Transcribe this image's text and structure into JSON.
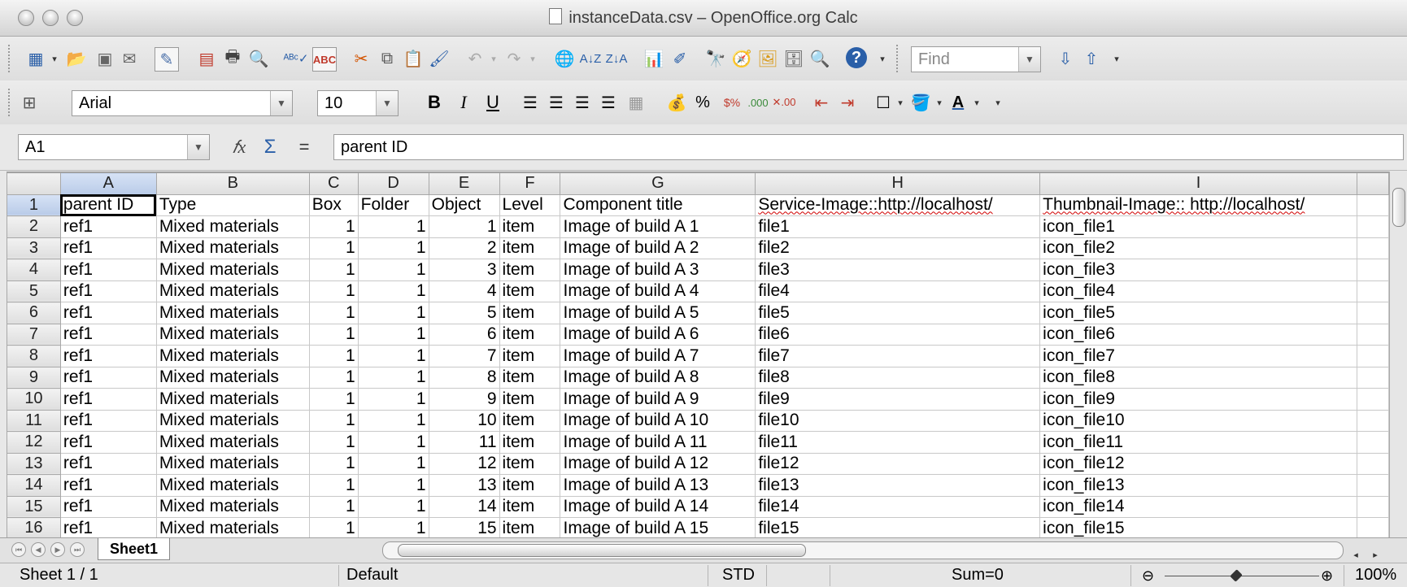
{
  "window": {
    "title": "instanceData.csv – OpenOffice.org Calc"
  },
  "toolbar": {
    "find_placeholder": "Find",
    "font_name": "Arial",
    "font_size": "10"
  },
  "formula_bar": {
    "name_box": "A1",
    "content": "parent ID"
  },
  "columns": [
    "A",
    "B",
    "C",
    "D",
    "E",
    "F",
    "G",
    "H",
    "I"
  ],
  "header_row": [
    "parent ID",
    "Type",
    "Box",
    "Folder",
    "Object",
    "Level",
    "Component title",
    "Service-Image::http://localhost/",
    "Thumbnail-Image:: http://localhost/"
  ],
  "rows": [
    [
      "2",
      "ref1",
      "Mixed materials",
      "1",
      "1",
      "1",
      "item",
      "Image of build A 1",
      "file1",
      "icon_file1"
    ],
    [
      "3",
      "ref1",
      "Mixed materials",
      "1",
      "1",
      "2",
      "item",
      "Image of build A 2",
      "file2",
      "icon_file2"
    ],
    [
      "4",
      "ref1",
      "Mixed materials",
      "1",
      "1",
      "3",
      "item",
      "Image of build A 3",
      "file3",
      "icon_file3"
    ],
    [
      "5",
      "ref1",
      "Mixed materials",
      "1",
      "1",
      "4",
      "item",
      "Image of build A 4",
      "file4",
      "icon_file4"
    ],
    [
      "6",
      "ref1",
      "Mixed materials",
      "1",
      "1",
      "5",
      "item",
      "Image of build A 5",
      "file5",
      "icon_file5"
    ],
    [
      "7",
      "ref1",
      "Mixed materials",
      "1",
      "1",
      "6",
      "item",
      "Image of build A 6",
      "file6",
      "icon_file6"
    ],
    [
      "8",
      "ref1",
      "Mixed materials",
      "1",
      "1",
      "7",
      "item",
      "Image of build A 7",
      "file7",
      "icon_file7"
    ],
    [
      "9",
      "ref1",
      "Mixed materials",
      "1",
      "1",
      "8",
      "item",
      "Image of build A 8",
      "file8",
      "icon_file8"
    ],
    [
      "10",
      "ref1",
      "Mixed materials",
      "1",
      "1",
      "9",
      "item",
      "Image of build A 9",
      "file9",
      "icon_file9"
    ],
    [
      "11",
      "ref1",
      "Mixed materials",
      "1",
      "1",
      "10",
      "item",
      "Image of build A 10",
      "file10",
      "icon_file10"
    ],
    [
      "12",
      "ref1",
      "Mixed materials",
      "1",
      "1",
      "11",
      "item",
      "Image of build A 11",
      "file11",
      "icon_file11"
    ],
    [
      "13",
      "ref1",
      "Mixed materials",
      "1",
      "1",
      "12",
      "item",
      "Image of build A 12",
      "file12",
      "icon_file12"
    ],
    [
      "14",
      "ref1",
      "Mixed materials",
      "1",
      "1",
      "13",
      "item",
      "Image of build A 13",
      "file13",
      "icon_file13"
    ],
    [
      "15",
      "ref1",
      "Mixed materials",
      "1",
      "1",
      "14",
      "item",
      "Image of build A 14",
      "file14",
      "icon_file14"
    ],
    [
      "16",
      "ref1",
      "Mixed materials",
      "1",
      "1",
      "15",
      "item",
      "Image of build A 15",
      "file15",
      "icon_file15"
    ]
  ],
  "sheet_tab": "Sheet1",
  "status_bar": {
    "sheet": "Sheet 1 / 1",
    "style": "Default",
    "mode": "STD",
    "sum": "Sum=0",
    "zoom": "100%"
  },
  "colors": {
    "selected_header": "#c6d4ee",
    "spell_underline": "#d00000"
  }
}
